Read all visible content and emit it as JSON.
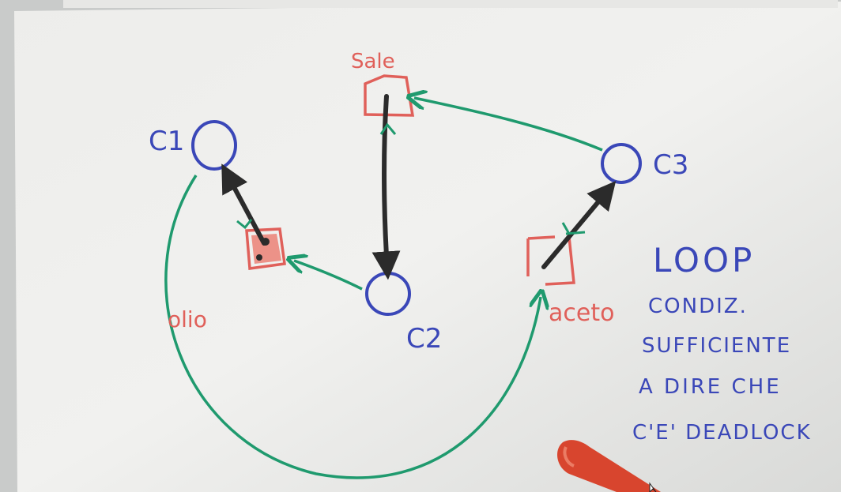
{
  "nodes": {
    "c1": "C1",
    "c2": "C2",
    "c3": "C3"
  },
  "resources": {
    "sale": "Sale",
    "olio": "olio",
    "aceto": "aceto"
  },
  "note": {
    "line1": "LOOP",
    "line2": "CONDIZ.",
    "line3": "SUFFICIENTE",
    "line4": "A DIRE CHE",
    "line5": "C'E' DEADLOCK"
  },
  "colors": {
    "process": "#3a47b8",
    "resource": "#e0605a",
    "request": "#1f9a6e",
    "assignment": "#2b2b2b",
    "marker": "#d8452e"
  }
}
